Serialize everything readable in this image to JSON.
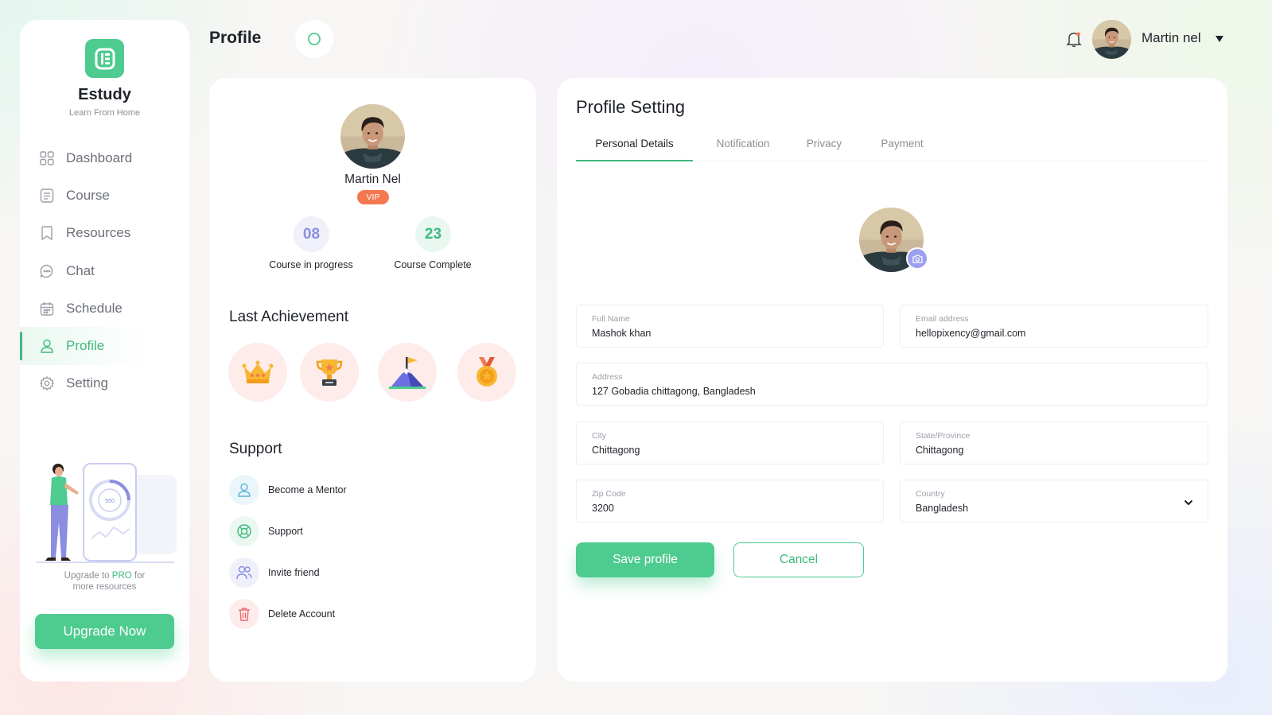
{
  "brand": {
    "name": "Estudy",
    "tagline": "Learn From Home",
    "color": "#4ecb8f"
  },
  "header": {
    "title": "Profile",
    "user_name": "Martin nel"
  },
  "sidebar": {
    "items": [
      {
        "label": "Dashboard",
        "icon": "dashboard-icon"
      },
      {
        "label": "Course",
        "icon": "course-icon"
      },
      {
        "label": "Resources",
        "icon": "bookmark-icon"
      },
      {
        "label": "Chat",
        "icon": "chat-icon"
      },
      {
        "label": "Schedule",
        "icon": "calendar-icon"
      },
      {
        "label": "Profile",
        "icon": "user-icon",
        "active": true
      },
      {
        "label": "Setting",
        "icon": "gear-icon"
      }
    ],
    "illustration_value": "550",
    "upgrade_text_pre": "Upgrade  to ",
    "upgrade_text_pro": "PRO",
    "upgrade_text_post": " for",
    "upgrade_text_line2": "more resources",
    "upgrade_button": "Upgrade Now"
  },
  "profile": {
    "name": "Martin Nel",
    "badge": "VIP",
    "stats": [
      {
        "value": "08",
        "label": "Course in progress"
      },
      {
        "value": "23",
        "label": "Course Complete"
      }
    ],
    "achievements_title": "Last Achievement",
    "achievements": [
      "crown-icon",
      "trophy-icon",
      "mountain-flag-icon",
      "medal-icon"
    ],
    "support_title": "Support",
    "support_items": [
      {
        "label": "Become a Mentor",
        "icon": "user-icon"
      },
      {
        "label": "Support",
        "icon": "lifebuoy-icon"
      },
      {
        "label": "Invite friend",
        "icon": "users-icon"
      },
      {
        "label": "Delete Account",
        "icon": "trash-icon"
      }
    ]
  },
  "settings": {
    "title": "Profile Setting",
    "tabs": [
      "Personal Details",
      "Notification",
      "Privacy",
      "Payment"
    ],
    "active_tab": "Personal Details",
    "fields": {
      "full_name": {
        "label": "Full Name",
        "value": "Mashok khan"
      },
      "email": {
        "label": "Email address",
        "value": "hellopixency@gmail.com"
      },
      "address": {
        "label": "Address",
        "value": "127 Gobadia chittagong, Bangladesh"
      },
      "city": {
        "label": "City",
        "value": "Chittagong"
      },
      "state": {
        "label": "State/Province",
        "value": "Chittagong"
      },
      "zip": {
        "label": "Zip Code",
        "value": "3200"
      },
      "country": {
        "label": "Country",
        "value": "Bangladesh"
      }
    },
    "save_button": "Save profile",
    "cancel_button": "Cancel"
  }
}
